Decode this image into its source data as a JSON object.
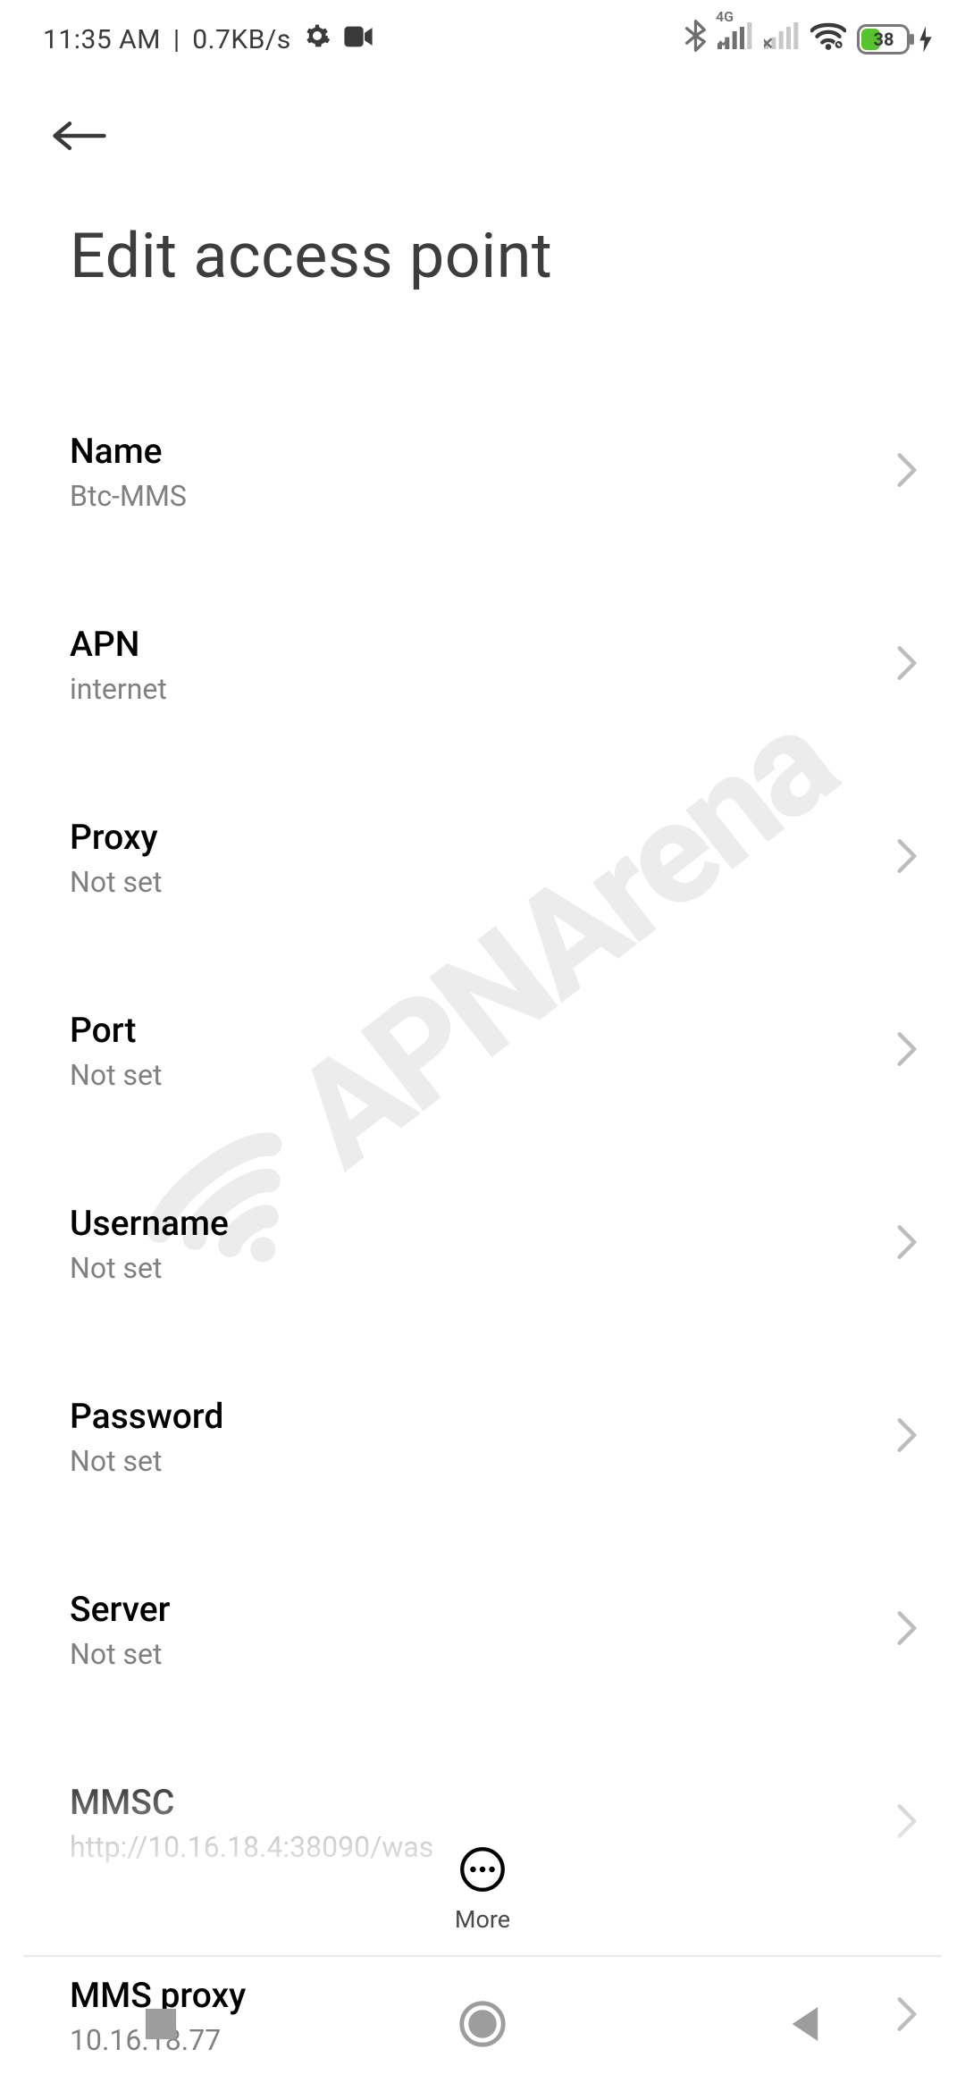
{
  "status": {
    "time": "11:35 AM",
    "sep": "|",
    "net_rate": "0.7KB/s",
    "battery": "38",
    "network_label": "4G"
  },
  "header": {
    "title": "Edit access point"
  },
  "rows": [
    {
      "label": "Name",
      "value": "Btc-MMS"
    },
    {
      "label": "APN",
      "value": "internet"
    },
    {
      "label": "Proxy",
      "value": "Not set"
    },
    {
      "label": "Port",
      "value": "Not set"
    },
    {
      "label": "Username",
      "value": "Not set"
    },
    {
      "label": "Password",
      "value": "Not set"
    },
    {
      "label": "Server",
      "value": "Not set"
    },
    {
      "label": "MMSC",
      "value": "http://10.16.18.4:38090/was"
    },
    {
      "label": "MMS proxy",
      "value": "10.16.18.77"
    }
  ],
  "footer": {
    "more_label": "More"
  },
  "watermark": "APNArena"
}
